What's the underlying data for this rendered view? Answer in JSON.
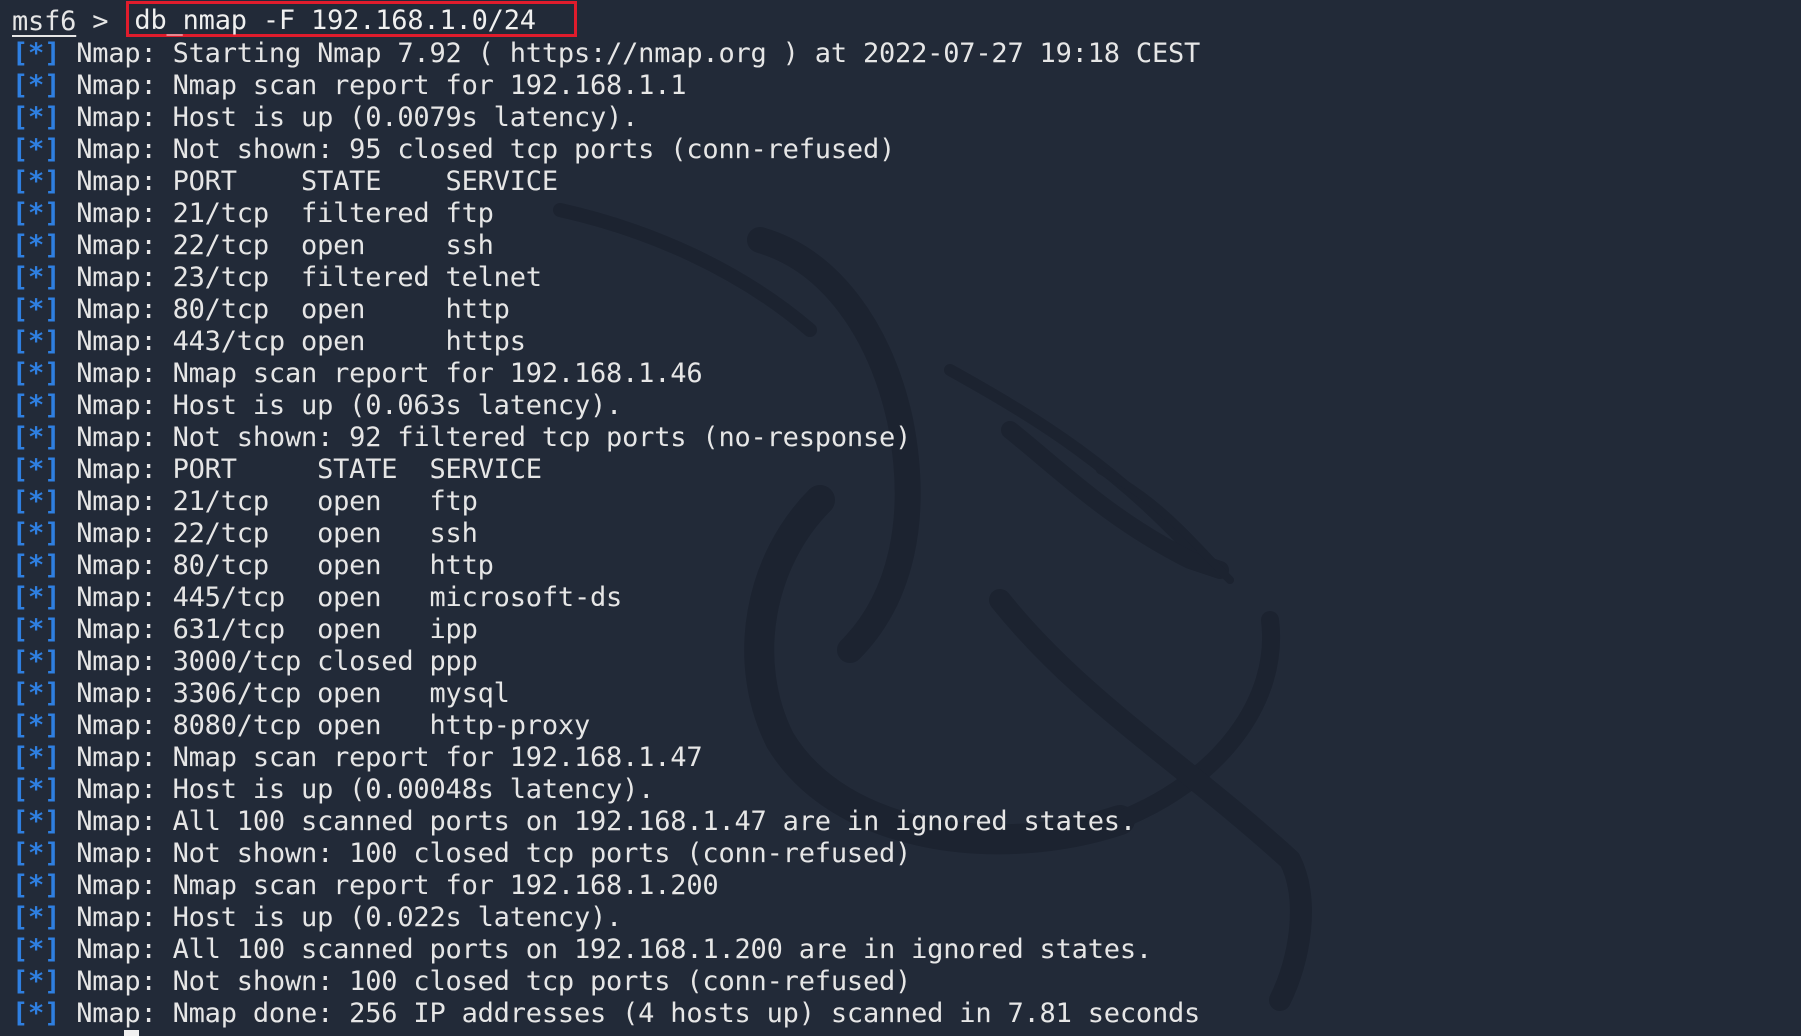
{
  "terminal": {
    "prompt": "msf6",
    "prompt_symbol": ">",
    "command": "db_nmap -F 192.168.1.0/24",
    "info_tag": "[*]",
    "colors": {
      "background": "#222a38",
      "text": "#e6e6e6",
      "info_tag": "#2f7fe0",
      "highlight_box": "#e01c2c"
    },
    "watermark_icon": "kali-dragon-icon",
    "output": [
      "Nmap: Starting Nmap 7.92 ( https://nmap.org ) at 2022-07-27 19:18 CEST",
      "Nmap: Nmap scan report for 192.168.1.1",
      "Nmap: Host is up (0.0079s latency).",
      "Nmap: Not shown: 95 closed tcp ports (conn-refused)",
      "Nmap: PORT    STATE    SERVICE",
      "Nmap: 21/tcp  filtered ftp",
      "Nmap: 22/tcp  open     ssh",
      "Nmap: 23/tcp  filtered telnet",
      "Nmap: 80/tcp  open     http",
      "Nmap: 443/tcp open     https",
      "Nmap: Nmap scan report for 192.168.1.46",
      "Nmap: Host is up (0.063s latency).",
      "Nmap: Not shown: 92 filtered tcp ports (no-response)",
      "Nmap: PORT     STATE  SERVICE",
      "Nmap: 21/tcp   open   ftp",
      "Nmap: 22/tcp   open   ssh",
      "Nmap: 80/tcp   open   http",
      "Nmap: 445/tcp  open   microsoft-ds",
      "Nmap: 631/tcp  open   ipp",
      "Nmap: 3000/tcp closed ppp",
      "Nmap: 3306/tcp open   mysql",
      "Nmap: 8080/tcp open   http-proxy",
      "Nmap: Nmap scan report for 192.168.1.47",
      "Nmap: Host is up (0.00048s latency).",
      "Nmap: All 100 scanned ports on 192.168.1.47 are in ignored states.",
      "Nmap: Not shown: 100 closed tcp ports (conn-refused)",
      "Nmap: Nmap scan report for 192.168.1.200",
      "Nmap: Host is up (0.022s latency).",
      "Nmap: All 100 scanned ports on 192.168.1.200 are in ignored states.",
      "Nmap: Not shown: 100 closed tcp ports (conn-refused)",
      "Nmap: Nmap done: 256 IP addresses (4 hosts up) scanned in 7.81 seconds"
    ]
  }
}
